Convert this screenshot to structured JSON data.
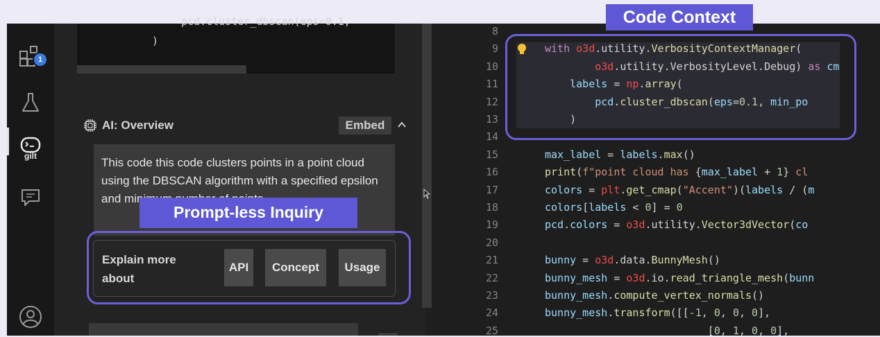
{
  "activity_bar": {
    "extensions_badge": "1"
  },
  "terminal": {
    "line1": "pcd.cluster_dbscan(eps=0.1,",
    "line2": ")"
  },
  "ai_overview": {
    "title": "AI: Overview",
    "embed_label": "Embed",
    "collapse_glyph": "^",
    "text": "This code this code clusters points in a point cloud using the DBSCAN algorithm with a specified epsilon and minimum number of points,"
  },
  "explain": {
    "label": "Explain more about",
    "chips": [
      "API",
      "Concept",
      "Usage"
    ]
  },
  "callouts": {
    "prompt_less": "Prompt-less Inquiry",
    "code_context": "Code Context"
  },
  "editor": {
    "lines": [
      {
        "n": "8",
        "html": ""
      },
      {
        "n": "9",
        "html": "<span class='kw'>with</span> <span class='mod'>o3d</span>.utility.<span class='fn'>VerbosityContextManager</span>("
      },
      {
        "n": "10",
        "html": "        <span class='mod'>o3d</span>.utility.VerbosityLevel.Debug) <span class='kw'>as</span> <span class='var'>cm</span>"
      },
      {
        "n": "11",
        "html": "    <span class='var'>labels</span> = <span class='mod'>np</span>.<span class='fn'>array</span>("
      },
      {
        "n": "12",
        "html": "        <span class='var'>pcd</span>.<span class='fn'>cluster_dbscan</span>(<span class='var'>eps</span>=<span class='num'>0.1</span>, <span class='var'>min_po</span>"
      },
      {
        "n": "13",
        "html": "    )"
      },
      {
        "n": "14",
        "html": ""
      },
      {
        "n": "15",
        "html": "<span class='var'>max_label</span> = <span class='var'>labels</span>.<span class='fn'>max</span>()"
      },
      {
        "n": "16",
        "html": "<span class='fn'>print</span>(<span class='str'>f\"point cloud has </span>{<span class='var'>max_label</span> + <span class='num'>1</span>}<span class='str'> cl</span>"
      },
      {
        "n": "17",
        "html": "<span class='var'>colors</span> = <span class='mod'>plt</span>.<span class='fn'>get_cmap</span>(<span class='str'>\"Accent\"</span>)(<span class='var'>labels</span> / (<span class='var'>m</span>"
      },
      {
        "n": "18",
        "html": "<span class='var'>colors</span>[<span class='var'>labels</span> &lt; <span class='num'>0</span>] = <span class='num'>0</span>"
      },
      {
        "n": "19",
        "html": "<span class='var'>pcd</span>.<span class='var'>colors</span> = <span class='mod'>o3d</span>.utility.<span class='fn'>Vector3dVector</span>(<span class='var'>co</span>"
      },
      {
        "n": "20",
        "html": ""
      },
      {
        "n": "21",
        "html": "<span class='var'>bunny</span> = <span class='mod'>o3d</span>.data.<span class='fn'>BunnyMesh</span>()"
      },
      {
        "n": "22",
        "html": "<span class='var'>bunny_mesh</span> = <span class='mod'>o3d</span>.io.<span class='fn'>read_triangle_mesh</span>(<span class='var'>bunn</span>"
      },
      {
        "n": "23",
        "html": "<span class='var'>bunny_mesh</span>.<span class='fn'>compute_vertex_normals</span>()"
      },
      {
        "n": "24",
        "html": "<span class='var'>bunny_mesh</span>.<span class='fn'>transform</span>([[<span class='num'>-1</span>, <span class='num'>0</span>, <span class='num'>0</span>, <span class='num'>0</span>],"
      },
      {
        "n": "25",
        "html": "                          [<span class='num'>0</span>, <span class='num'>1</span>, <span class='num'>0</span>, <span class='num'>0</span>],"
      }
    ]
  },
  "colors": {
    "callout_border": "#6a60d8",
    "callout_tag": "#5e57d6",
    "background": "#ecebf6",
    "editor_bg": "#1e1e1e",
    "badge": "#3a7be0"
  }
}
